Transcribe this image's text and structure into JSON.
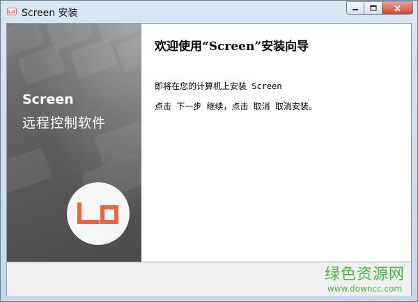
{
  "window": {
    "title": "Screen 安装",
    "app_icon": "screen-app-icon",
    "controls": {
      "minimize": "minimize-icon",
      "maximize": "maximize-icon",
      "close": "close-icon"
    }
  },
  "banner": {
    "title": "Screen",
    "subtitle": "远程控制软件",
    "logo": "screen-logo-icon",
    "logo_color": "#e8653f"
  },
  "content": {
    "heading": "欢迎使用“Screen”安装向导",
    "line1": "即将在您的计算机上安装 Screen",
    "line2": "点击 下一步 继续，点击 取消 取消安装。"
  },
  "watermark": {
    "title": "绿色资源网",
    "url": "www.downcc.com",
    "color": "#4ab548"
  }
}
